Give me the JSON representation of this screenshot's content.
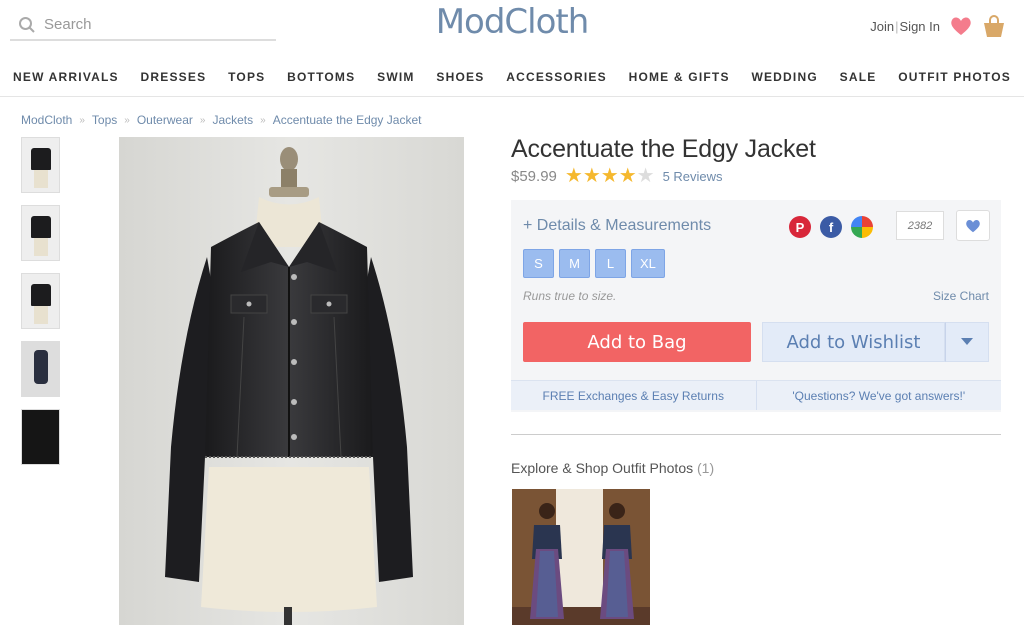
{
  "header": {
    "search_placeholder": "Search",
    "logo": "ModCloth",
    "join": "Join",
    "sign_in": "Sign In"
  },
  "nav": [
    "NEW ARRIVALS",
    "DRESSES",
    "TOPS",
    "BOTTOMS",
    "SWIM",
    "SHOES",
    "ACCESSORIES",
    "HOME & GIFTS",
    "WEDDING",
    "SALE",
    "OUTFIT PHOTOS"
  ],
  "breadcrumb": [
    "ModCloth",
    "Tops",
    "Outerwear",
    "Jackets",
    "Accentuate the Edgy Jacket"
  ],
  "product": {
    "title": "Accentuate the Edgy Jacket",
    "price": "$59.99",
    "rating": 4,
    "rating_max": 5,
    "reviews": "5 Reviews",
    "details_link": "+ Details & Measurements",
    "save_count": "2382",
    "sizes": [
      "S",
      "M",
      "L",
      "XL"
    ],
    "fit_note": "Runs true to size.",
    "size_chart": "Size Chart",
    "add_to_bag": "Add to Bag",
    "add_to_wishlist": "Add to Wishlist",
    "perk_left": "FREE Exchanges & Easy Returns",
    "perk_right": "'Questions? We've got answers!'"
  },
  "explore": {
    "label": "Explore & Shop Outfit Photos",
    "count": "(1)"
  },
  "colors": {
    "brand": "#6f8bab",
    "add_to_bag": "#f26464",
    "size_button": "#9bbcef",
    "star": "#f5b82e"
  }
}
